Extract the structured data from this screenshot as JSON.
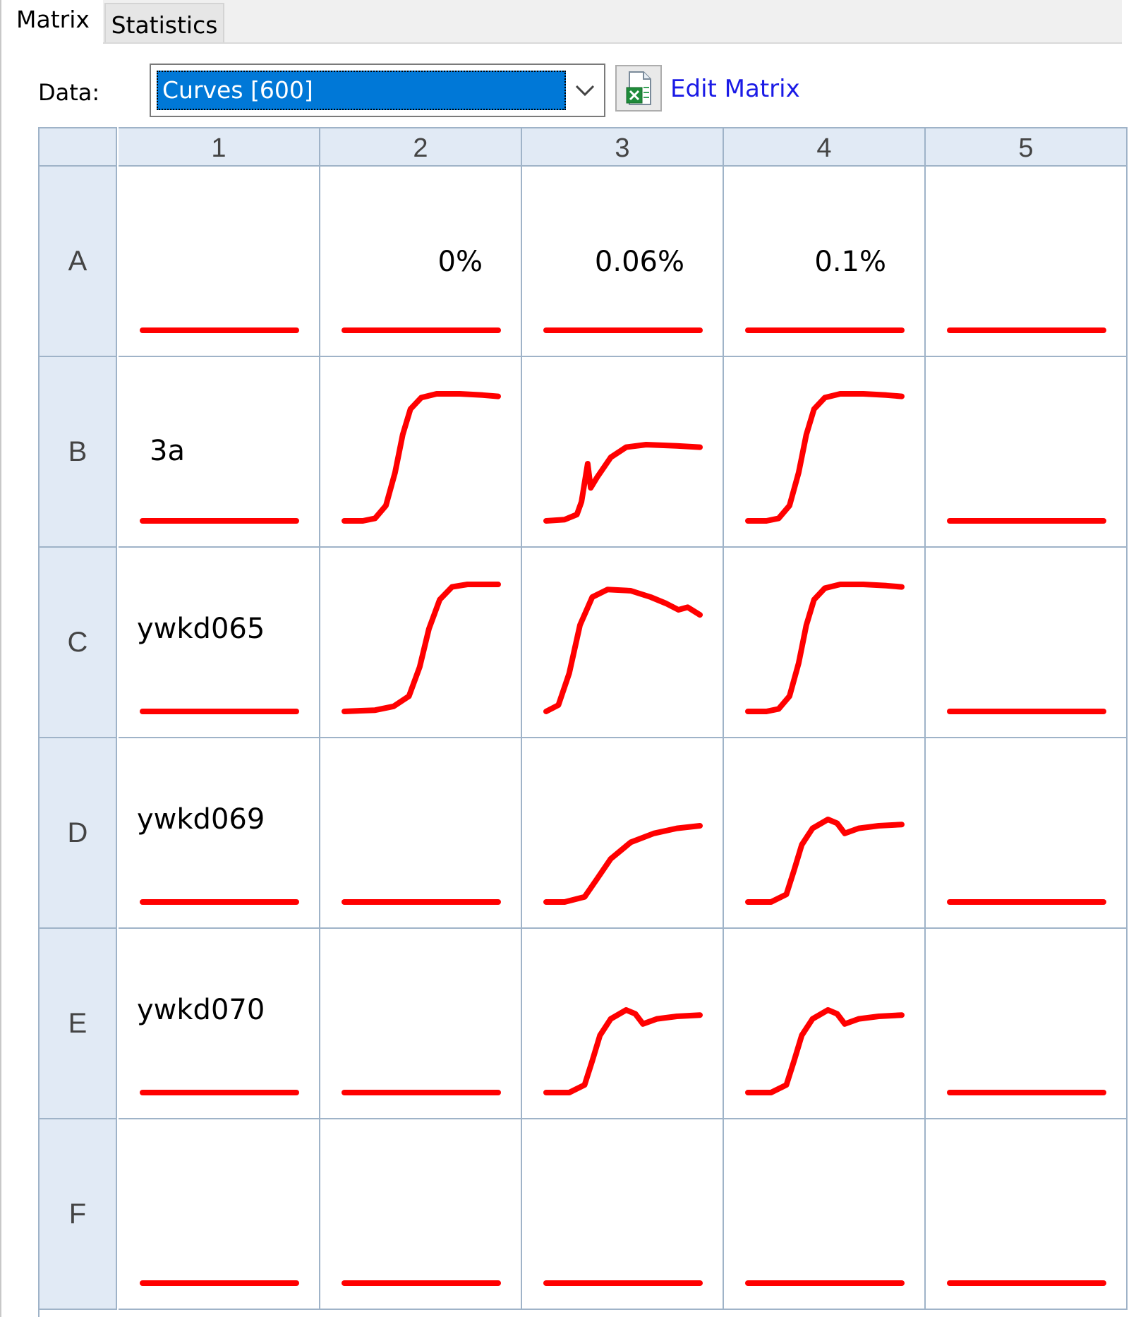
{
  "tabs": [
    {
      "label": "Matrix",
      "active": true
    },
    {
      "label": "Statistics",
      "active": false
    }
  ],
  "toolbar": {
    "data_label": "Data:",
    "selected_data": "Curves [600]",
    "edit_button_icon": "excel-icon",
    "edit_link": "Edit Matrix"
  },
  "grid": {
    "columns": [
      "1",
      "2",
      "3",
      "4",
      "5"
    ],
    "rows": [
      "A",
      "B",
      "C",
      "D",
      "E",
      "F"
    ],
    "curve_color": "#ff0000",
    "cells": [
      [
        {
          "label": "",
          "curve": "flat"
        },
        {
          "label": "0%",
          "curve": "flat"
        },
        {
          "label": "0.06%",
          "curve": "flat"
        },
        {
          "label": "0.1%",
          "curve": "flat"
        },
        {
          "label": "",
          "curve": "flat"
        }
      ],
      [
        {
          "label": "3a",
          "curve": "flat"
        },
        {
          "label": "",
          "curve": "sigmoid-high"
        },
        {
          "label": "",
          "curve": "sigmoid-low-glitch"
        },
        {
          "label": "",
          "curve": "sigmoid-high"
        },
        {
          "label": "",
          "curve": "flat"
        }
      ],
      [
        {
          "label": "ywkd065",
          "curve": "flat"
        },
        {
          "label": "",
          "curve": "sigmoid-late"
        },
        {
          "label": "",
          "curve": "sigmoid-peak-decline"
        },
        {
          "label": "",
          "curve": "sigmoid-high"
        },
        {
          "label": "",
          "curve": "flat"
        }
      ],
      [
        {
          "label": "ywkd069",
          "curve": "flat"
        },
        {
          "label": "",
          "curve": "flat"
        },
        {
          "label": "",
          "curve": "sigmoid-slow-mid"
        },
        {
          "label": "",
          "curve": "sigmoid-mid-bump"
        },
        {
          "label": "",
          "curve": "flat"
        }
      ],
      [
        {
          "label": "ywkd070",
          "curve": "flat"
        },
        {
          "label": "",
          "curve": "flat"
        },
        {
          "label": "",
          "curve": "sigmoid-mid-bump"
        },
        {
          "label": "",
          "curve": "sigmoid-mid-bump"
        },
        {
          "label": "",
          "curve": "flat"
        }
      ],
      [
        {
          "label": "",
          "curve": "flat"
        },
        {
          "label": "",
          "curve": "flat"
        },
        {
          "label": "",
          "curve": "flat"
        },
        {
          "label": "",
          "curve": "flat"
        },
        {
          "label": "",
          "curve": "flat"
        }
      ]
    ]
  }
}
